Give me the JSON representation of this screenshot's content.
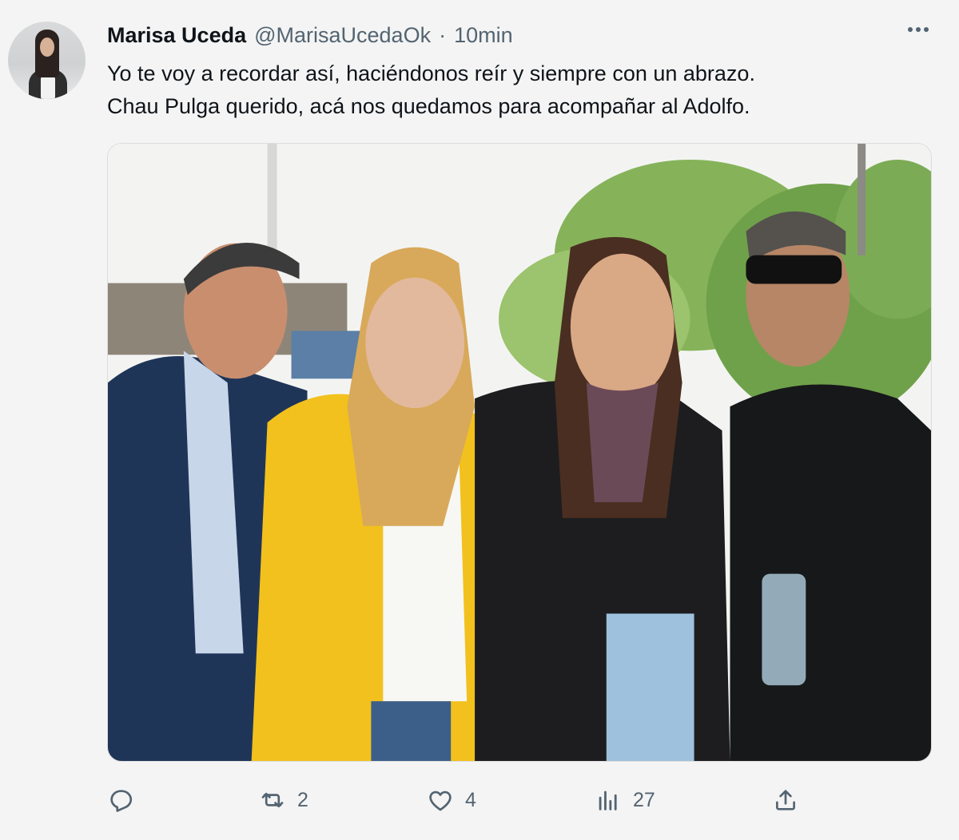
{
  "author": {
    "name": "Marisa Uceda",
    "handle": "@MarisaUcedaOk",
    "separator": "·",
    "time": "10min"
  },
  "tweet": {
    "lines": [
      "Yo te voy a recordar así, haciéndonos reír y siempre con un abrazo.",
      "Chau Pulga querido, acá nos quedamos para acompañar al Adolfo."
    ]
  },
  "actions": {
    "reply_count": "",
    "retweet_count": "2",
    "like_count": "4",
    "views_count": "27"
  },
  "icons": {
    "avatar": "profile-photo",
    "more": "more-options-icon",
    "reply": "reply-icon",
    "retweet": "retweet-icon",
    "like": "heart-icon",
    "views": "views-chart-icon",
    "share": "share-upload-icon"
  },
  "colors": {
    "text": "#0f1419",
    "secondary": "#536471",
    "background": "#f4f4f4"
  }
}
